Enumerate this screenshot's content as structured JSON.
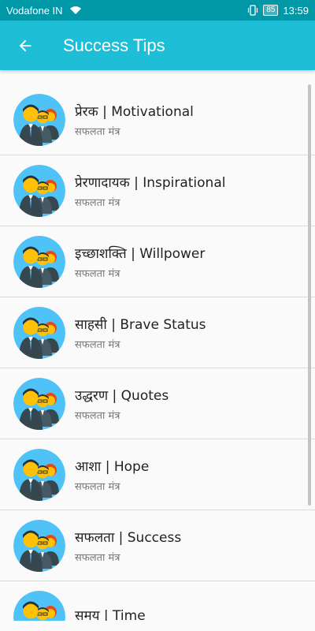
{
  "status_bar": {
    "carrier": "Vodafone IN",
    "battery": "85",
    "time": "13:59"
  },
  "app_bar": {
    "title": "Success Tips",
    "back_icon": "arrow-left-icon"
  },
  "list": {
    "items": [
      {
        "title": "प्रेरक  |  Motivational",
        "subtitle": "सफलता मंत्र"
      },
      {
        "title": " प्रेरणादायक  |  Inspirational",
        "subtitle": "सफलता मंत्र"
      },
      {
        "title": " इच्छाशक्ति  |  Willpower",
        "subtitle": "सफलता मंत्र"
      },
      {
        "title": "साहसी  |  Brave Status",
        "subtitle": "सफलता मंत्र"
      },
      {
        "title": "उद्धरण  |  Quotes",
        "subtitle": "सफलता मंत्र"
      },
      {
        "title": "आशा  |  Hope",
        "subtitle": "सफलता मंत्र"
      },
      {
        "title": "सफलता  |  Success",
        "subtitle": "सफलता मंत्र"
      },
      {
        "title": "समय  |  Time",
        "subtitle": ""
      }
    ]
  },
  "colors": {
    "status_bar": "#0097a7",
    "app_bar": "#1ebfd6",
    "avatar_bg": "#4fc3f7"
  }
}
